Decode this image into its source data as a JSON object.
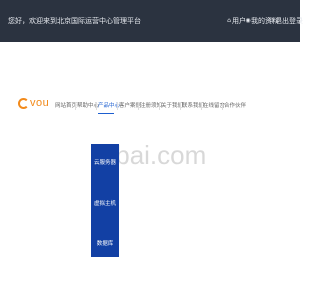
{
  "topbar": {
    "left_text": "您好，欢迎来到北京国际运营中心管理平台",
    "user_label": "用户",
    "profile_label": "我的资料",
    "logout_label": "退出登录",
    "icons": [
      "user-icon",
      "profile-icon",
      "logout-icon"
    ]
  },
  "logo": {
    "text": "vou"
  },
  "nav": {
    "items": [
      {
        "label": "网站首页"
      },
      {
        "label": "帮助中心"
      },
      {
        "label": "产品中心"
      },
      {
        "label": "客户案例"
      },
      {
        "label": "注册须知"
      },
      {
        "label": "关于我们"
      },
      {
        "label": "联系我们"
      },
      {
        "label": "在线留言"
      },
      {
        "label": "合作伙伴"
      }
    ],
    "active_index": 2
  },
  "dropdown": {
    "items": [
      "云服务器",
      "虚拟主机",
      "数据库"
    ]
  },
  "watermark": {
    "text": "uibai.com"
  },
  "colors": {
    "topbar": "#2b3340",
    "accent": "#1d5fd0",
    "dropdown": "#1240a4",
    "logo": "#f28a1a"
  }
}
